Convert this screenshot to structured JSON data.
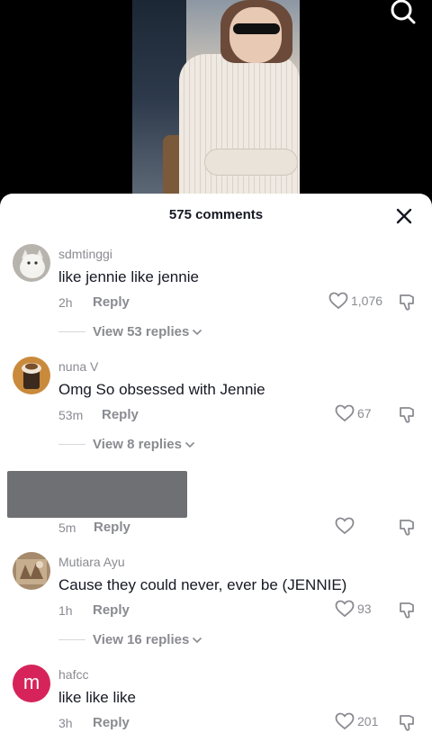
{
  "video": {
    "search_icon": "search-icon"
  },
  "comments_sheet": {
    "title": "575 comments",
    "close_icon": "close-icon"
  },
  "comments": [
    {
      "username": "sdmtinggi",
      "text": "like jennie like jennie",
      "time": "2h",
      "reply_label": "Reply",
      "likes": "1,076",
      "view_replies": "View 53 replies"
    },
    {
      "username": "nuna V",
      "text": "Omg So obsessed with Jennie",
      "time": "53m",
      "reply_label": "Reply",
      "likes": "67",
      "view_replies": "View 8 replies"
    },
    {
      "username": "",
      "text": "",
      "time": "5m",
      "reply_label": "Reply",
      "likes": "",
      "view_replies": ""
    },
    {
      "username": "Mutiara Ayu",
      "text": "Cause they could never, ever be (JENNIE)",
      "time": "1h",
      "reply_label": "Reply",
      "likes": "93",
      "view_replies": "View 16 replies"
    },
    {
      "username": "hafcc",
      "avatar_letter": "m",
      "text": "like like like",
      "time": "3h",
      "reply_label": "Reply",
      "likes": "201",
      "view_replies": ""
    }
  ],
  "colors": {
    "sheet_bg": "#ffffff",
    "secondary_text": "#8a8b91",
    "primary_text": "#161823",
    "avatar_m_bg": "#d6245b"
  }
}
